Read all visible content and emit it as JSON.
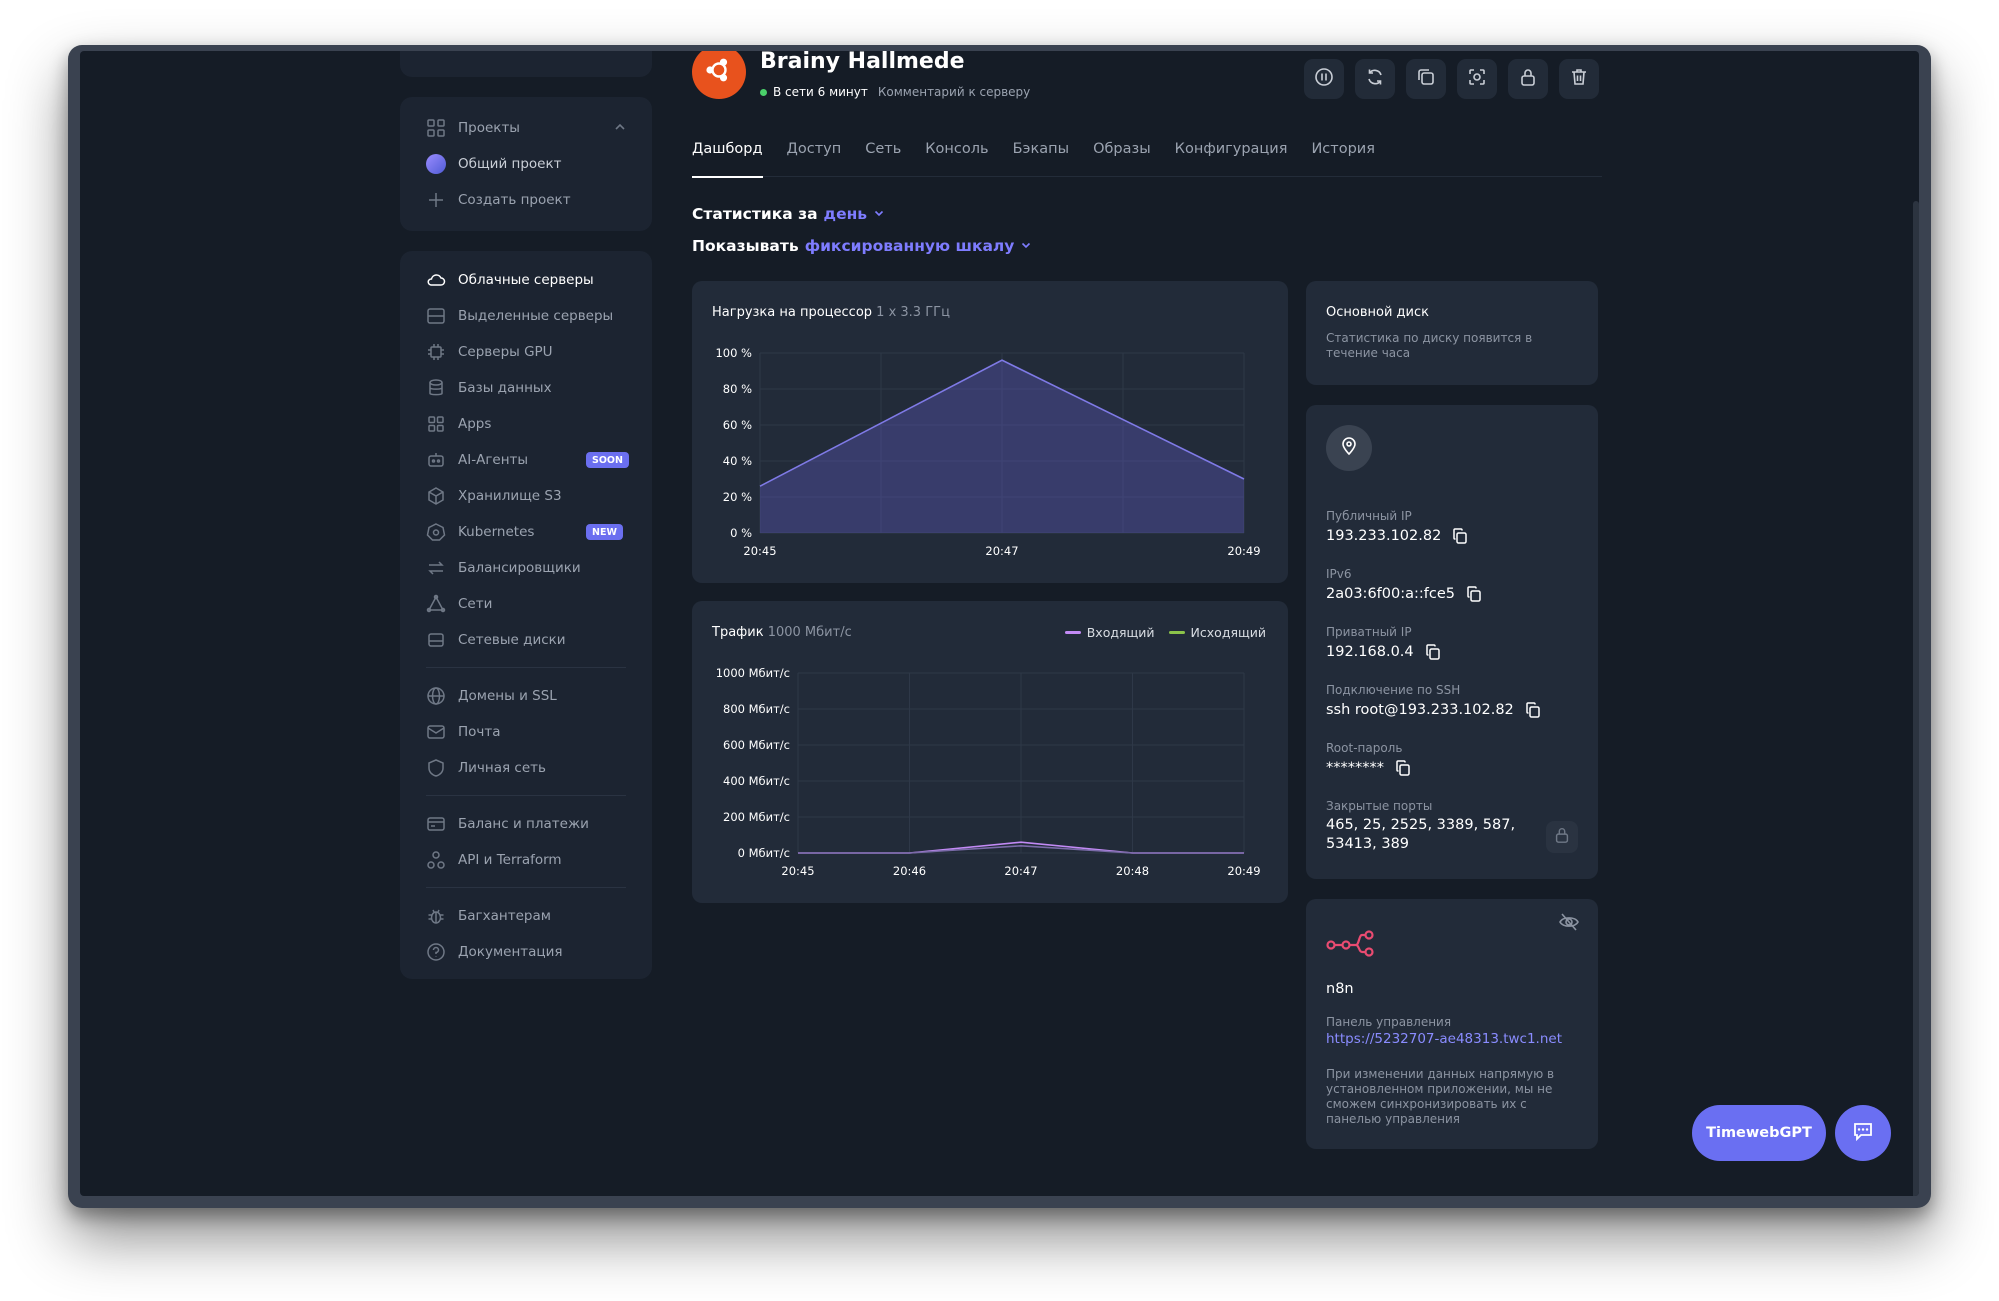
{
  "sidebar": {
    "projects": {
      "header": "Проекты",
      "items": [
        {
          "label": "Общий проект",
          "icon": "project-avatar-icon"
        },
        {
          "label": "Создать проект",
          "icon": "plus-icon"
        }
      ]
    },
    "items": [
      {
        "label": "Облачные серверы",
        "icon": "cloud-icon",
        "active": true
      },
      {
        "label": "Выделенные серверы",
        "icon": "server-icon"
      },
      {
        "label": "Серверы GPU",
        "icon": "gpu-icon"
      },
      {
        "label": "Базы данных",
        "icon": "database-icon"
      },
      {
        "label": "Apps",
        "icon": "apps-icon"
      },
      {
        "label": "AI-Агенты",
        "icon": "robot-icon",
        "badge": "SOON"
      },
      {
        "label": "Хранилище S3",
        "icon": "cube-icon"
      },
      {
        "label": "Kubernetes",
        "icon": "kubernetes-icon",
        "badge": "NEW"
      },
      {
        "label": "Балансировщики",
        "icon": "arrows-icon"
      },
      {
        "label": "Сети",
        "icon": "network-icon"
      },
      {
        "label": "Сетевые диски",
        "icon": "disk-icon"
      },
      {
        "label": "Домены и SSL",
        "icon": "globe-icon"
      },
      {
        "label": "Почта",
        "icon": "mail-icon"
      },
      {
        "label": "Личная сеть",
        "icon": "shield-icon"
      },
      {
        "label": "Баланс и платежи",
        "icon": "card-icon"
      },
      {
        "label": "API и Terraform",
        "icon": "api-icon"
      },
      {
        "label": "Багхантерам",
        "icon": "bug-icon"
      },
      {
        "label": "Документация",
        "icon": "help-icon"
      }
    ]
  },
  "header": {
    "server_name": "Brainy Hallmede",
    "status": "В сети 6 минут",
    "comment": "Комментарий к серверу",
    "toolbar": [
      "pause-icon",
      "restart-icon",
      "clone-icon",
      "snapshot-icon",
      "lock-icon",
      "trash-icon"
    ]
  },
  "tabs": [
    "Дашборд",
    "Доступ",
    "Сеть",
    "Консоль",
    "Бэкапы",
    "Образы",
    "Конфигурация",
    "История"
  ],
  "stats": {
    "period_prefix": "Статистика за",
    "period_value": "день",
    "scale_prefix": "Показывать",
    "scale_value": "фиксированную шкалу"
  },
  "cpu": {
    "title": "Нагрузка на процессор",
    "sub": "1 x 3.3 ГГц"
  },
  "traffic": {
    "title": "Трафик",
    "sub": "1000 Мбит/с",
    "legend_in": "Входящий",
    "legend_out": "Исходящий",
    "color_in": "#c28af5",
    "color_out": "#8bc34a"
  },
  "chart_data": [
    {
      "type": "area",
      "x": [
        "20:45",
        "20:47",
        "20:49"
      ],
      "series": [
        {
          "values": [
            26,
            96,
            30
          ]
        }
      ],
      "yticks": [
        "0 %",
        "20 %",
        "40 %",
        "60 %",
        "80 %",
        "100 %"
      ],
      "ylim": [
        0,
        100
      ],
      "grid": true
    },
    {
      "type": "line",
      "x": [
        "20:45",
        "20:46",
        "20:47",
        "20:48",
        "20:49"
      ],
      "series": [
        {
          "name": "Входящий",
          "values": [
            0,
            0,
            60,
            0,
            0
          ]
        },
        {
          "name": "Исходящий",
          "values": [
            0,
            0,
            40,
            0,
            0
          ]
        }
      ],
      "yticks": [
        "0 Мбит/с",
        "200 Мбит/с",
        "400 Мбит/с",
        "600 Мбит/с",
        "800 Мбит/с",
        "1000 Мбит/с"
      ],
      "ylim": [
        0,
        1000
      ],
      "grid": true
    }
  ],
  "disk": {
    "title": "Основной диск",
    "note": "Статистика по диску появится в течение часа"
  },
  "info": {
    "public_ip_label": "Публичный IP",
    "public_ip": "193.233.102.82",
    "ipv6_label": "IPv6",
    "ipv6": "2a03:6f00:a::fce5",
    "private_ip_label": "Приватный IP",
    "private_ip": "192.168.0.4",
    "ssh_label": "Подключение по SSH",
    "ssh": "ssh root@193.233.102.82",
    "root_label": "Root-пароль",
    "root": "********",
    "ports_label": "Закрытые порты",
    "ports_line1": "465, 25, 2525, 3389, 587,",
    "ports_line2": "53413, 389"
  },
  "app": {
    "name": "n8n",
    "panel_label": "Панель управления",
    "panel_url": "https://5232707-ae48313.twc1.net",
    "note": "При изменении данных напрямую в установленном приложении, мы не сможем синхронизировать их с панелью управления"
  },
  "buttons": {
    "gpt": "TimewebGPT"
  }
}
